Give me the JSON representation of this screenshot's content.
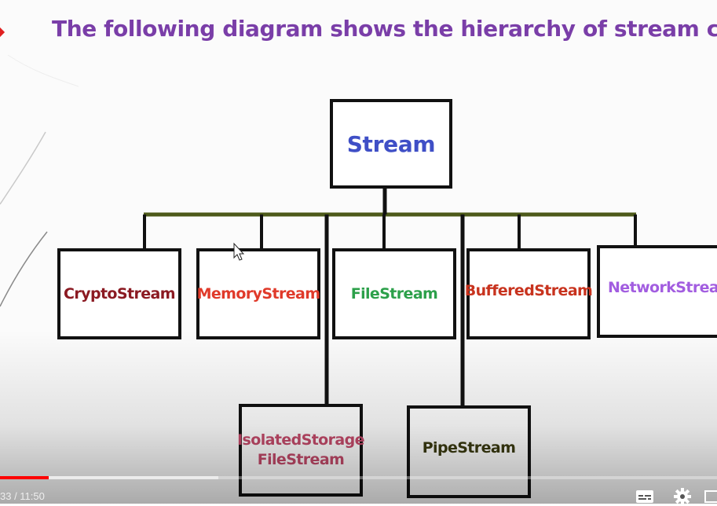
{
  "slide": {
    "title": "The following diagram shows the hierarchy of stream classes:",
    "title_color": "#7a3ea8",
    "root": {
      "label": "Stream",
      "color": "#3f4fc6"
    },
    "children": [
      {
        "label": "CryptoStream",
        "color": "#8b1a22"
      },
      {
        "label": "MemoryStream",
        "color": "#e03a2a"
      },
      {
        "label": "FileStream",
        "color": "#2ca04a"
      },
      {
        "label": "BufferedStream",
        "color": "#c8331e"
      },
      {
        "label": "NetworkStream",
        "color": "#a25de0"
      }
    ],
    "lower_children": [
      {
        "label_line1": "IsolatedStorage",
        "label_line2": "FileStream",
        "color": "#c44a6a"
      },
      {
        "label": "PipeStream",
        "color": "#3a3a10"
      }
    ],
    "connector_color": "#4d5a1a"
  },
  "player": {
    "time_display": "33 / 11:50",
    "played_fraction": 0.068,
    "buffered_fraction": 0.305,
    "played_color": "#ff0000",
    "buttons": [
      {
        "name": "subtitles-icon"
      },
      {
        "name": "settings-gear-icon"
      },
      {
        "name": "miniplayer-icon"
      }
    ]
  }
}
